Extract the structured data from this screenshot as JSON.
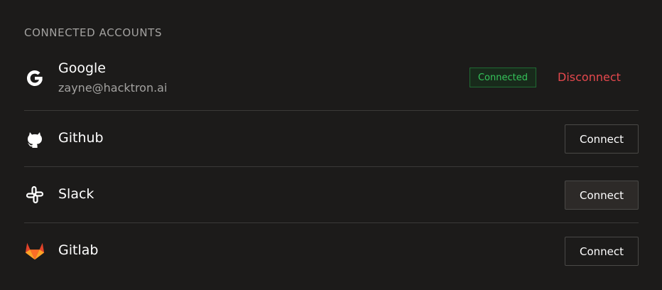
{
  "section": {
    "title": "CONNECTED ACCOUNTS"
  },
  "accounts": [
    {
      "name": "Google",
      "email": "zayne@hacktron.ai",
      "status": "Connected",
      "action": "Disconnect",
      "icon": "google-icon"
    },
    {
      "name": "Github",
      "action": "Connect",
      "icon": "github-icon"
    },
    {
      "name": "Slack",
      "action": "Connect",
      "icon": "slack-icon",
      "hovered": true
    },
    {
      "name": "Gitlab",
      "action": "Connect",
      "icon": "gitlab-icon"
    }
  ],
  "colors": {
    "background": "#1c1b1a",
    "divider": "#3b3a38",
    "muted_text": "#a3a2a0",
    "connected_green": "#35c45a",
    "disconnect_red": "#e5484d",
    "gitlab_orange": "#fc6d26"
  }
}
